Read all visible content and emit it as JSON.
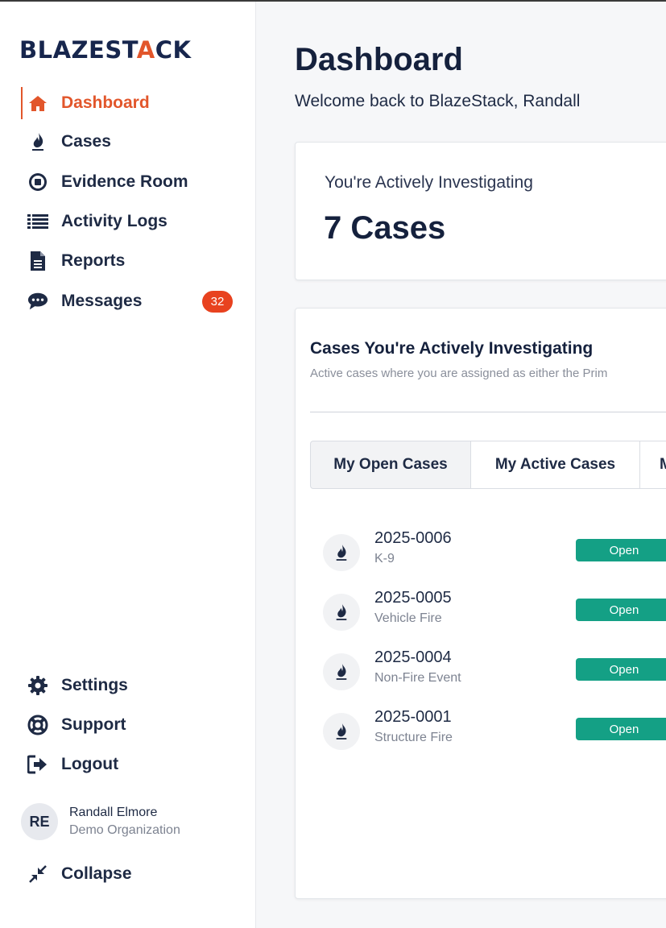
{
  "app": {
    "logo_prefix": "BLAZEST",
    "logo_accent": "A",
    "logo_suffix": "CK",
    "accent_color": "#e2562b",
    "brand_color": "#17264d",
    "status_open_color": "#14a085"
  },
  "sidebar": {
    "nav": [
      {
        "label": "Dashboard",
        "icon": "home-icon",
        "active": true
      },
      {
        "label": "Cases",
        "icon": "flame-icon"
      },
      {
        "label": "Evidence Room",
        "icon": "stop-circle-icon"
      },
      {
        "label": "Activity Logs",
        "icon": "list-icon"
      },
      {
        "label": "Reports",
        "icon": "document-icon"
      },
      {
        "label": "Messages",
        "icon": "chat-icon",
        "badge": "32"
      }
    ],
    "bottom": [
      {
        "label": "Settings",
        "icon": "gear-icon"
      },
      {
        "label": "Support",
        "icon": "lifebuoy-icon"
      },
      {
        "label": "Logout",
        "icon": "logout-icon"
      }
    ],
    "user": {
      "initials": "RE",
      "name": "Randall Elmore",
      "org": "Demo Organization"
    },
    "collapse_label": "Collapse"
  },
  "main": {
    "title": "Dashboard",
    "subtitle": "Welcome back to BlazeStack, Randall",
    "summary": {
      "label": "You're Actively Investigating",
      "value": "7 Cases"
    },
    "cases_card": {
      "title": "Cases You're Actively Investigating",
      "description": "Active cases where you are assigned as either the Prim",
      "tabs": [
        {
          "label": "My Open Cases",
          "active": true
        },
        {
          "label": "My Active Cases"
        },
        {
          "label": "M"
        }
      ],
      "cases": [
        {
          "number": "2025-0006",
          "type": "K-9",
          "status": "Open"
        },
        {
          "number": "2025-0005",
          "type": "Vehicle Fire",
          "status": "Open"
        },
        {
          "number": "2025-0004",
          "type": "Non-Fire Event",
          "status": "Open"
        },
        {
          "number": "2025-0001",
          "type": "Structure Fire",
          "status": "Open"
        }
      ]
    }
  }
}
